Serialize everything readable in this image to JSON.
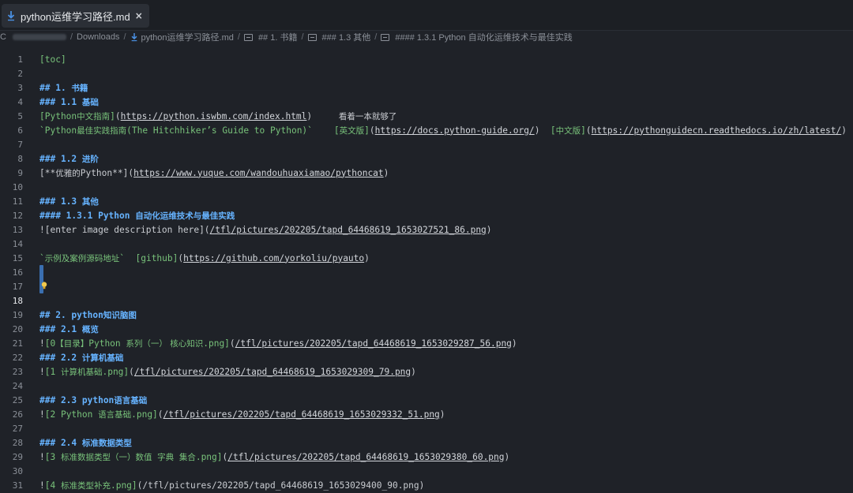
{
  "tab": {
    "title": "python运维学习路径.md",
    "close": "×"
  },
  "breadcrumb": {
    "drive": "C",
    "downloads": "Downloads",
    "file": "python运维学习路径.md",
    "h1": "## 1. 书籍",
    "h2": "### 1.3 其他",
    "h3": "#### 1.3.1 Python 自动化运维技术与最佳实践"
  },
  "lines": [
    {
      "n": "1",
      "parts": [
        {
          "c": "g",
          "t": "[toc]"
        }
      ]
    },
    {
      "n": "2",
      "parts": []
    },
    {
      "n": "3",
      "parts": [
        {
          "c": "h",
          "t": "## 1. "
        },
        {
          "c": "h cn",
          "t": "书籍"
        }
      ]
    },
    {
      "n": "4",
      "parts": [
        {
          "c": "h",
          "t": "### 1.1 "
        },
        {
          "c": "h cn",
          "t": "基础"
        }
      ]
    },
    {
      "n": "5",
      "parts": [
        {
          "c": "g",
          "t": "[Python"
        },
        {
          "c": "g cn",
          "t": "中文指南"
        },
        {
          "c": "g",
          "t": "]"
        },
        {
          "c": "w",
          "t": "("
        },
        {
          "c": "u",
          "t": "https://python.iswbm.com/index.html"
        },
        {
          "c": "w",
          "t": ")     "
        },
        {
          "c": "w cn",
          "t": "看着一本就够了"
        }
      ]
    },
    {
      "n": "6",
      "parts": [
        {
          "c": "g",
          "t": "`Python"
        },
        {
          "c": "g cn",
          "t": "最佳实践指南"
        },
        {
          "c": "g",
          "t": "(The Hitchhiker’s Guide to Python)`"
        },
        {
          "c": "w",
          "t": "    "
        },
        {
          "c": "g",
          "t": "["
        },
        {
          "c": "g cn",
          "t": "英文版"
        },
        {
          "c": "g",
          "t": "]"
        },
        {
          "c": "w",
          "t": "("
        },
        {
          "c": "u",
          "t": "https://docs.python-guide.org/"
        },
        {
          "c": "w",
          "t": ")  "
        },
        {
          "c": "g",
          "t": "["
        },
        {
          "c": "g cn",
          "t": "中文版"
        },
        {
          "c": "g",
          "t": "]"
        },
        {
          "c": "w",
          "t": "("
        },
        {
          "c": "u",
          "t": "https://pythonguidecn.readthedocs.io/zh/latest/"
        },
        {
          "c": "w",
          "t": ")"
        }
      ]
    },
    {
      "n": "7",
      "parts": []
    },
    {
      "n": "8",
      "parts": [
        {
          "c": "h",
          "t": "### 1.2 "
        },
        {
          "c": "h cn",
          "t": "进阶"
        }
      ]
    },
    {
      "n": "9",
      "parts": [
        {
          "c": "w",
          "t": "[**"
        },
        {
          "c": "w cn",
          "t": "优雅的"
        },
        {
          "c": "w",
          "t": "Python**]("
        },
        {
          "c": "u",
          "t": "https://www.yuque.com/wandouhuaxiamao/pythoncat"
        },
        {
          "c": "w",
          "t": ")"
        }
      ]
    },
    {
      "n": "10",
      "parts": []
    },
    {
      "n": "11",
      "parts": [
        {
          "c": "h",
          "t": "### 1.3 "
        },
        {
          "c": "h cn",
          "t": "其他"
        }
      ]
    },
    {
      "n": "12",
      "parts": [
        {
          "c": "h",
          "t": "#### 1.3.1 Python "
        },
        {
          "c": "h cn",
          "t": "自动化运维技术与最佳实践"
        }
      ]
    },
    {
      "n": "13",
      "parts": [
        {
          "c": "w",
          "t": "![enter image description here]("
        },
        {
          "c": "u",
          "t": "/tfl/pictures/202205/tapd_64468619_1653027521_86.png"
        },
        {
          "c": "w",
          "t": ")"
        }
      ]
    },
    {
      "n": "14",
      "parts": []
    },
    {
      "n": "15",
      "parts": [
        {
          "c": "g",
          "t": "`"
        },
        {
          "c": "g cn",
          "t": "示例及案例源码地址"
        },
        {
          "c": "g",
          "t": "`"
        },
        {
          "c": "w",
          "t": "  "
        },
        {
          "c": "g",
          "t": "[github]"
        },
        {
          "c": "w",
          "t": "("
        },
        {
          "c": "u",
          "t": "https://github.com/yorkoliu/pyauto"
        },
        {
          "c": "w",
          "t": ")"
        }
      ]
    },
    {
      "n": "16",
      "parts": []
    },
    {
      "n": "17",
      "parts": []
    },
    {
      "n": "18",
      "parts": [],
      "active": true
    },
    {
      "n": "19",
      "parts": [
        {
          "c": "h",
          "t": "## 2. python"
        },
        {
          "c": "h cn",
          "t": "知识脑图"
        }
      ]
    },
    {
      "n": "20",
      "parts": [
        {
          "c": "h",
          "t": "### 2.1 "
        },
        {
          "c": "h cn",
          "t": "概览"
        }
      ]
    },
    {
      "n": "21",
      "parts": [
        {
          "c": "w",
          "t": "!"
        },
        {
          "c": "g",
          "t": "[0"
        },
        {
          "c": "g cn",
          "t": "【目录】"
        },
        {
          "c": "g",
          "t": "Python "
        },
        {
          "c": "g cn",
          "t": "系列（一） 核心知识"
        },
        {
          "c": "g",
          "t": ".png]"
        },
        {
          "c": "w",
          "t": "("
        },
        {
          "c": "u",
          "t": "/tfl/pictures/202205/tapd_64468619_1653029287_56.png"
        },
        {
          "c": "w",
          "t": ")"
        }
      ]
    },
    {
      "n": "22",
      "parts": [
        {
          "c": "h",
          "t": "### 2.2 "
        },
        {
          "c": "h cn",
          "t": "计算机基础"
        }
      ]
    },
    {
      "n": "23",
      "parts": [
        {
          "c": "w",
          "t": "!"
        },
        {
          "c": "g",
          "t": "[1 "
        },
        {
          "c": "g cn",
          "t": "计算机基础"
        },
        {
          "c": "g",
          "t": ".png]"
        },
        {
          "c": "w",
          "t": "("
        },
        {
          "c": "u",
          "t": "/tfl/pictures/202205/tapd_64468619_1653029309_79.png"
        },
        {
          "c": "w",
          "t": ")"
        }
      ]
    },
    {
      "n": "24",
      "parts": []
    },
    {
      "n": "25",
      "parts": [
        {
          "c": "h",
          "t": "### 2.3 python"
        },
        {
          "c": "h cn",
          "t": "语言基础"
        }
      ]
    },
    {
      "n": "26",
      "parts": [
        {
          "c": "w",
          "t": "!"
        },
        {
          "c": "g",
          "t": "[2 Python "
        },
        {
          "c": "g cn",
          "t": "语言基础"
        },
        {
          "c": "g",
          "t": ".png]"
        },
        {
          "c": "w",
          "t": "("
        },
        {
          "c": "u",
          "t": "/tfl/pictures/202205/tapd_64468619_1653029332_51.png"
        },
        {
          "c": "w",
          "t": ")"
        }
      ]
    },
    {
      "n": "27",
      "parts": []
    },
    {
      "n": "28",
      "parts": [
        {
          "c": "h",
          "t": "### 2.4 "
        },
        {
          "c": "h cn",
          "t": "标准数据类型"
        }
      ]
    },
    {
      "n": "29",
      "parts": [
        {
          "c": "w",
          "t": "!"
        },
        {
          "c": "g",
          "t": "[3 "
        },
        {
          "c": "g cn",
          "t": "标准数据类型（一）数值  字典  集合"
        },
        {
          "c": "g",
          "t": ".png]"
        },
        {
          "c": "w",
          "t": "("
        },
        {
          "c": "u",
          "t": "/tfl/pictures/202205/tapd_64468619_1653029380_60.png"
        },
        {
          "c": "w",
          "t": ")"
        }
      ]
    },
    {
      "n": "30",
      "parts": []
    },
    {
      "n": "31",
      "parts": [
        {
          "c": "w",
          "t": "!"
        },
        {
          "c": "g",
          "t": "[4 "
        },
        {
          "c": "g cn",
          "t": "标准类型补充"
        },
        {
          "c": "g",
          "t": ".png]"
        },
        {
          "c": "w",
          "t": "(/tfl/pictures/202205/tapd_64468619_1653029400_90.png)"
        }
      ]
    }
  ]
}
